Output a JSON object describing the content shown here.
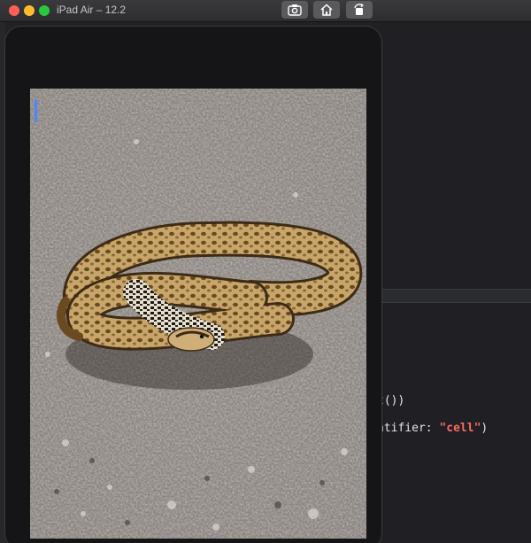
{
  "window": {
    "title": "iPad Air – 12.2",
    "controls": [
      "close",
      "minimize",
      "zoom"
    ]
  },
  "toolbar": {
    "icons": [
      "camera-icon",
      "home-icon",
      "rotate-icon"
    ]
  },
  "editor": {
    "line1": "t())",
    "line2_prefix": "ntifier: ",
    "line2_string": "\"cell\"",
    "line2_suffix": ")"
  },
  "photo": {
    "subject": "snake on gravel"
  },
  "colors": {
    "close": "#fe5f57",
    "minimize": "#febc2e",
    "zoom": "#28c840",
    "scroll_indicator": "#4a86ff",
    "string_literal": "#fc6a5d"
  }
}
